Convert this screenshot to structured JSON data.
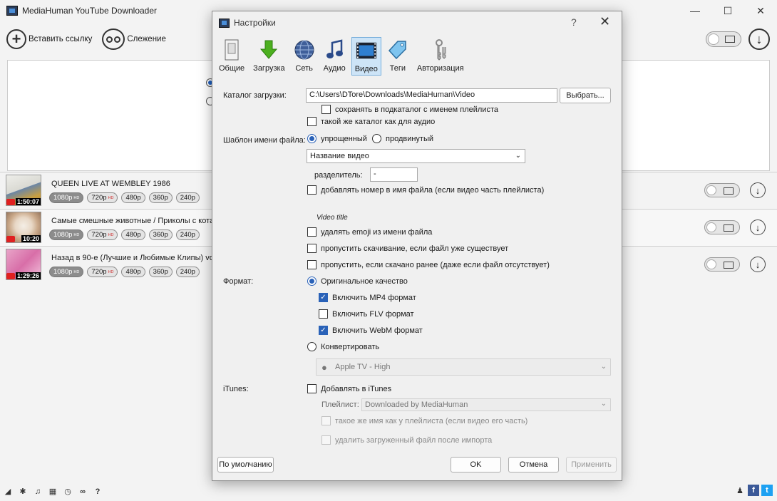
{
  "app": {
    "title": "MediaHuman YouTube Downloader",
    "window_controls": {
      "minimize": "—",
      "maximize": "☐",
      "close": "✕"
    }
  },
  "toolbar": {
    "paste_link": "Вставить ссылку",
    "tracking": "Слежение"
  },
  "downloads": [
    {
      "title": "QUEEN LIVE AT WEMBLEY 1986",
      "duration": "1:50:07",
      "qualities": [
        "1080p",
        "720p",
        "480p",
        "360p",
        "240p"
      ],
      "hd": "HD"
    },
    {
      "title": "Самые смешные животные / Приколы с кота",
      "duration": "10:20",
      "qualities": [
        "1080p",
        "720p",
        "480p",
        "360p",
        "240p"
      ],
      "hd": "HD"
    },
    {
      "title": "Назад в 90-е (Лучшие и Любимые Клипы)  vo",
      "duration": "1:29:26",
      "qualities": [
        "1080p",
        "720p",
        "480p",
        "360p",
        "240p"
      ],
      "hd": "HD"
    }
  ],
  "dialog": {
    "title": "Настройки",
    "help": "?",
    "close": "✕",
    "tabs": [
      {
        "label": "Общие",
        "icon": "general-icon"
      },
      {
        "label": "Загрузка",
        "icon": "download-arrow-icon"
      },
      {
        "label": "Сеть",
        "icon": "globe-icon"
      },
      {
        "label": "Аудио",
        "icon": "music-note-icon"
      },
      {
        "label": "Видео",
        "icon": "film-icon"
      },
      {
        "label": "Теги",
        "icon": "tag-icon"
      },
      {
        "label": "Авторизация",
        "icon": "keys-icon"
      }
    ],
    "active_tab": "Видео",
    "download_dir_label": "Каталог загрузки:",
    "download_dir": "C:\\Users\\DTore\\Downloads\\MediaHuman\\Video",
    "browse": "Выбрать...",
    "subdir_playlist": "сохранять в подкаталог с именем плейлиста",
    "same_as_audio": "такой же каталог как для аудио",
    "filename_template_label": "Шаблон имени файла:",
    "template_simple": "упрощенный",
    "template_advanced": "продвинутый",
    "template_value": "Название видео",
    "separator_label": "разделитель:",
    "separator_value": "-",
    "add_number": "добавлять номер в имя файла (если видео часть плейлиста)",
    "preview": "Video title",
    "remove_emoji": "удалять emoji из имени файла",
    "skip_existing": "пропустить скачивание, если файл уже существует",
    "skip_downloaded": "пропустить, если скачано ранее (даже если файл отсутствует)",
    "format_label": "Формат:",
    "original_quality": "Оригинальное качество",
    "mp4": "Включить MP4 формат",
    "flv": "Включить FLV формат",
    "webm": "Включить WebM формат",
    "convert": "Конвертировать",
    "convert_preset": "Apple TV - High",
    "itunes_label": "iTunes:",
    "add_itunes": "Добавлять в iTunes",
    "playlist_label": "Плейлист:",
    "playlist_value": "Downloaded by MediaHuman",
    "same_name_playlist": "такое же имя как у плейлиста (если видео его часть)",
    "delete_after_import": "удалить загруженный файл после импорта",
    "defaults": "По умолчанию",
    "ok": "OK",
    "cancel": "Отмена",
    "apply": "Применить"
  }
}
